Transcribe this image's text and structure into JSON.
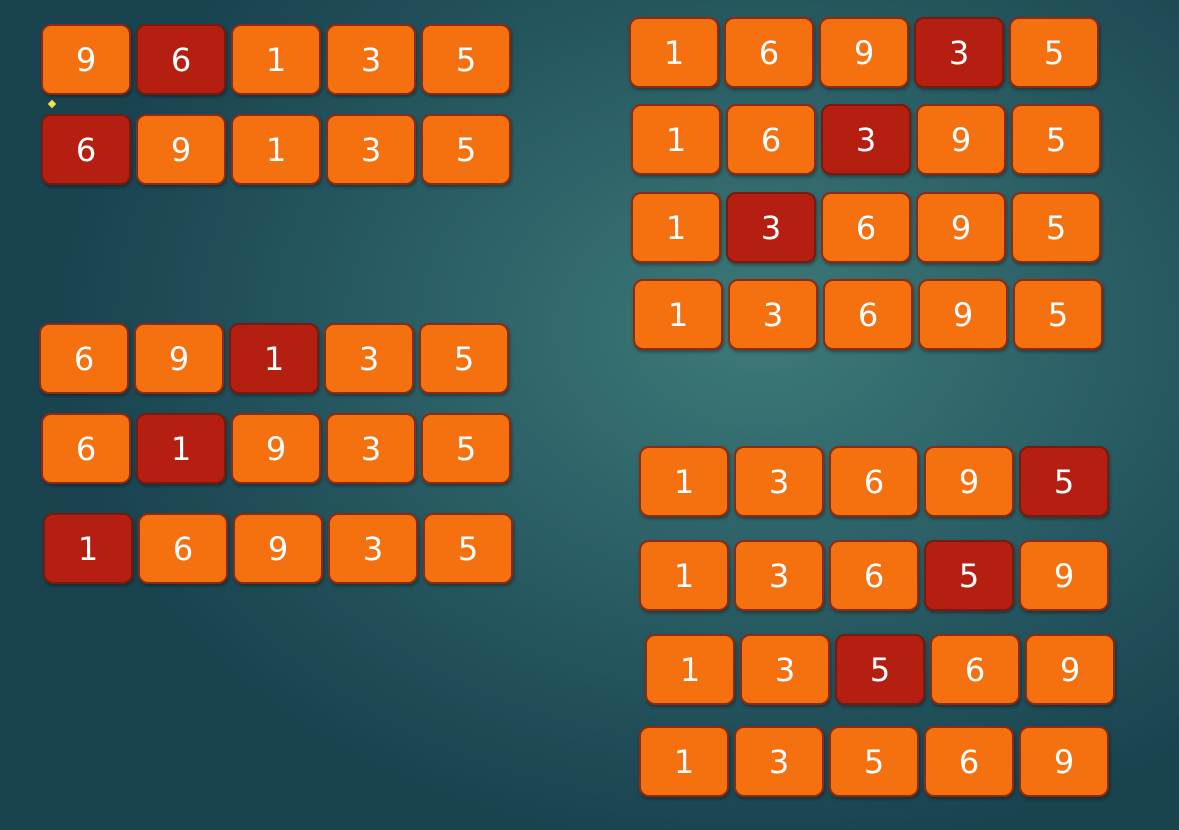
{
  "colors": {
    "normal": "#f5700f",
    "highlight": "#b51f12",
    "border": "#8e2a12",
    "text": "#ffffff"
  },
  "rows": [
    {
      "cells": [
        "9",
        "6",
        "1",
        "3",
        "5"
      ],
      "highlight": 1
    },
    {
      "cells": [
        "6",
        "9",
        "1",
        "3",
        "5"
      ],
      "highlight": 0
    },
    {
      "cells": [
        "6",
        "9",
        "1",
        "3",
        "5"
      ],
      "highlight": 2
    },
    {
      "cells": [
        "6",
        "1",
        "9",
        "3",
        "5"
      ],
      "highlight": 1
    },
    {
      "cells": [
        "1",
        "6",
        "9",
        "3",
        "5"
      ],
      "highlight": 0
    },
    {
      "cells": [
        "1",
        "6",
        "9",
        "3",
        "5"
      ],
      "highlight": 3
    },
    {
      "cells": [
        "1",
        "6",
        "3",
        "9",
        "5"
      ],
      "highlight": 2
    },
    {
      "cells": [
        "1",
        "3",
        "6",
        "9",
        "5"
      ],
      "highlight": 1
    },
    {
      "cells": [
        "1",
        "3",
        "6",
        "9",
        "5"
      ],
      "highlight": -1
    },
    {
      "cells": [
        "1",
        "3",
        "6",
        "9",
        "5"
      ],
      "highlight": 4
    },
    {
      "cells": [
        "1",
        "3",
        "6",
        "5",
        "9"
      ],
      "highlight": 3
    },
    {
      "cells": [
        "1",
        "3",
        "5",
        "6",
        "9"
      ],
      "highlight": 2
    },
    {
      "cells": [
        "1",
        "3",
        "5",
        "6",
        "9"
      ],
      "highlight": -1
    }
  ]
}
